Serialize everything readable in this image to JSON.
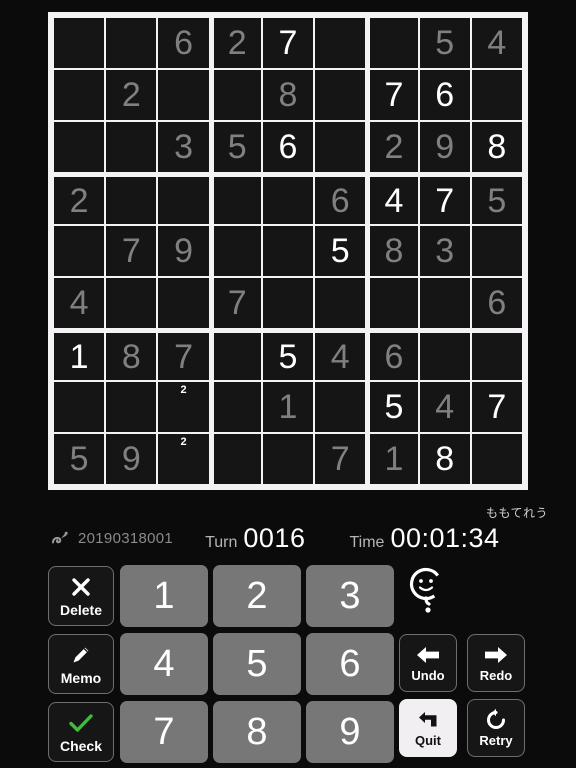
{
  "board": {
    "rows": [
      [
        {
          "v": "",
          "t": ""
        },
        {
          "v": "",
          "t": ""
        },
        {
          "v": "6",
          "t": "given"
        },
        {
          "v": "2",
          "t": "given"
        },
        {
          "v": "7",
          "t": "user"
        },
        {
          "v": "",
          "t": ""
        },
        {
          "v": "",
          "t": ""
        },
        {
          "v": "5",
          "t": "given"
        },
        {
          "v": "4",
          "t": "given"
        }
      ],
      [
        {
          "v": "",
          "t": ""
        },
        {
          "v": "2",
          "t": "given"
        },
        {
          "v": "",
          "t": ""
        },
        {
          "v": "",
          "t": ""
        },
        {
          "v": "8",
          "t": "given"
        },
        {
          "v": "",
          "t": ""
        },
        {
          "v": "7",
          "t": "user"
        },
        {
          "v": "6",
          "t": "user"
        },
        {
          "v": "",
          "t": ""
        }
      ],
      [
        {
          "v": "",
          "t": ""
        },
        {
          "v": "",
          "t": ""
        },
        {
          "v": "3",
          "t": "given"
        },
        {
          "v": "5",
          "t": "given"
        },
        {
          "v": "6",
          "t": "user"
        },
        {
          "v": "",
          "t": ""
        },
        {
          "v": "2",
          "t": "given"
        },
        {
          "v": "9",
          "t": "given"
        },
        {
          "v": "8",
          "t": "user"
        }
      ],
      [
        {
          "v": "2",
          "t": "given"
        },
        {
          "v": "",
          "t": ""
        },
        {
          "v": "",
          "t": ""
        },
        {
          "v": "",
          "t": ""
        },
        {
          "v": "",
          "t": ""
        },
        {
          "v": "6",
          "t": "given"
        },
        {
          "v": "4",
          "t": "user"
        },
        {
          "v": "7",
          "t": "user"
        },
        {
          "v": "5",
          "t": "given"
        }
      ],
      [
        {
          "v": "",
          "t": ""
        },
        {
          "v": "7",
          "t": "given"
        },
        {
          "v": "9",
          "t": "given"
        },
        {
          "v": "",
          "t": ""
        },
        {
          "v": "",
          "t": ""
        },
        {
          "v": "5",
          "t": "user"
        },
        {
          "v": "8",
          "t": "given"
        },
        {
          "v": "3",
          "t": "given"
        },
        {
          "v": "",
          "t": ""
        }
      ],
      [
        {
          "v": "4",
          "t": "given"
        },
        {
          "v": "",
          "t": ""
        },
        {
          "v": "",
          "t": ""
        },
        {
          "v": "7",
          "t": "given"
        },
        {
          "v": "",
          "t": ""
        },
        {
          "v": "",
          "t": ""
        },
        {
          "v": "",
          "t": ""
        },
        {
          "v": "",
          "t": ""
        },
        {
          "v": "6",
          "t": "given"
        }
      ],
      [
        {
          "v": "1",
          "t": "user"
        },
        {
          "v": "8",
          "t": "given"
        },
        {
          "v": "7",
          "t": "given"
        },
        {
          "v": "",
          "t": ""
        },
        {
          "v": "5",
          "t": "user"
        },
        {
          "v": "4",
          "t": "given"
        },
        {
          "v": "6",
          "t": "given"
        },
        {
          "v": "",
          "t": ""
        },
        {
          "v": "",
          "t": ""
        }
      ],
      [
        {
          "v": "",
          "t": ""
        },
        {
          "v": "",
          "t": ""
        },
        {
          "v": "",
          "t": "",
          "memo": "2"
        },
        {
          "v": "",
          "t": ""
        },
        {
          "v": "1",
          "t": "given"
        },
        {
          "v": "",
          "t": ""
        },
        {
          "v": "5",
          "t": "user"
        },
        {
          "v": "4",
          "t": "given"
        },
        {
          "v": "7",
          "t": "user"
        }
      ],
      [
        {
          "v": "5",
          "t": "given"
        },
        {
          "v": "9",
          "t": "given"
        },
        {
          "v": "",
          "t": "",
          "memo": "2"
        },
        {
          "v": "",
          "t": ""
        },
        {
          "v": "",
          "t": ""
        },
        {
          "v": "7",
          "t": "given"
        },
        {
          "v": "1",
          "t": "given"
        },
        {
          "v": "8",
          "t": "user"
        },
        {
          "v": "",
          "t": ""
        }
      ]
    ]
  },
  "status": {
    "nickname": "ももてれう",
    "id_icon": "snail-icon",
    "game_id": "20190318001",
    "turn_label": "Turn",
    "turn_value": "0016",
    "time_label": "Time",
    "time_value": "00:01:34"
  },
  "pad": {
    "delete_label": "Delete",
    "memo_label": "Memo",
    "check_label": "Check",
    "numbers": [
      "1",
      "2",
      "3",
      "4",
      "5",
      "6",
      "7",
      "8",
      "9"
    ],
    "hint_icon": "smiley-question-icon",
    "undo_label": "Undo",
    "redo_label": "Redo",
    "quit_label": "Quit",
    "retry_label": "Retry"
  },
  "colors": {
    "background": "#0b0b0b",
    "bezel": "#f4f2f4",
    "cell": "#151515",
    "given": "#808080",
    "user": "#ffffff",
    "numpad": "#777777",
    "quit_bg": "#f2eff2",
    "check_green": "#3fbb3f"
  }
}
